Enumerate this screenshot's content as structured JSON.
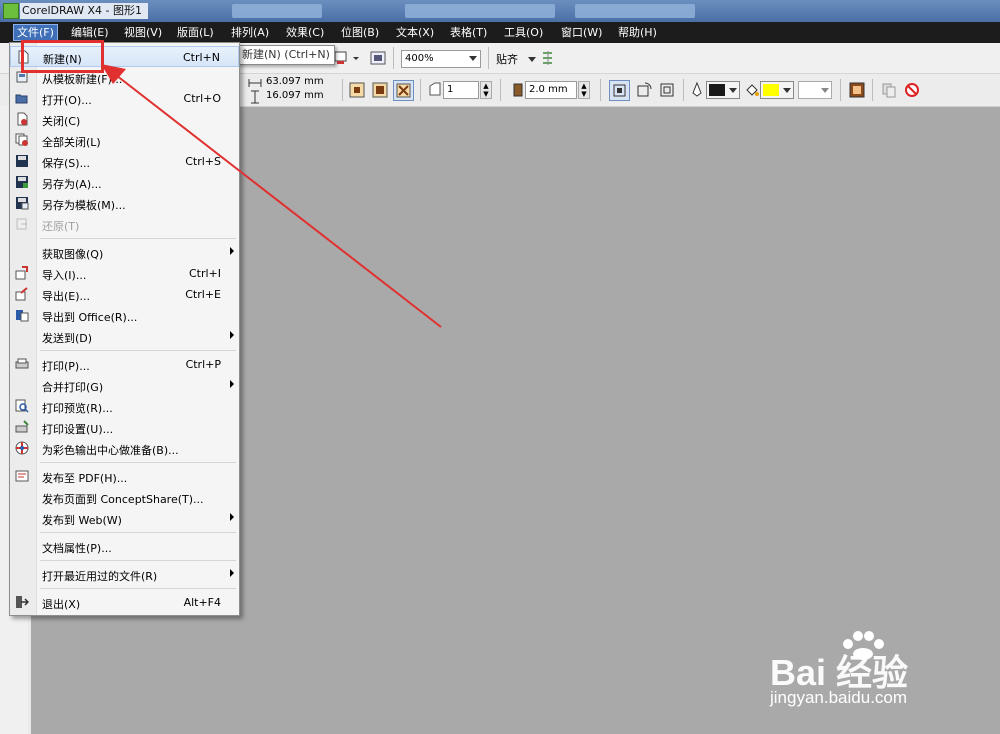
{
  "window": {
    "title": "CorelDRAW X4 - 图形1"
  },
  "menubar": [
    {
      "label": "文件(F)",
      "active": true
    },
    {
      "label": "编辑(E)"
    },
    {
      "label": "视图(V)"
    },
    {
      "label": "版面(L)"
    },
    {
      "label": "排列(A)"
    },
    {
      "label": "效果(C)"
    },
    {
      "label": "位图(B)"
    },
    {
      "label": "文本(X)"
    },
    {
      "label": "表格(T)"
    },
    {
      "label": "工具(O)"
    },
    {
      "label": "窗口(W)"
    },
    {
      "label": "帮助(H)"
    }
  ],
  "toolbar": {
    "zoom_value": "400%",
    "snap_label": "贴齐",
    "width_value": "63.097 mm",
    "height_value": "16.097 mm",
    "page_count": "1",
    "outline_width": "2.0 mm",
    "outline_color": "#1a1a1a",
    "fill_color": "#ffff00"
  },
  "tooltip": {
    "text": "新建(N) (Ctrl+N)"
  },
  "file_menu": {
    "items": [
      {
        "label": "新建(N)",
        "shortcut": "Ctrl+N",
        "icon": "new-document-icon",
        "highlighted": true
      },
      {
        "label": "从模板新建(F)...",
        "shortcut": "",
        "icon": "new-from-template-icon"
      },
      {
        "label": "打开(O)...",
        "shortcut": "Ctrl+O",
        "icon": "open-folder-icon"
      },
      {
        "label": "关闭(C)",
        "shortcut": "",
        "icon": "close-document-icon"
      },
      {
        "label": "全部关闭(L)",
        "shortcut": "",
        "icon": "close-all-icon"
      },
      {
        "label": "保存(S)...",
        "shortcut": "Ctrl+S",
        "icon": "save-icon"
      },
      {
        "label": "另存为(A)...",
        "shortcut": "",
        "icon": "save-as-icon"
      },
      {
        "label": "另存为模板(M)...",
        "shortcut": "",
        "icon": "save-as-template-icon"
      },
      {
        "label": "还原(T)",
        "shortcut": "",
        "icon": "revert-icon",
        "disabled": true
      },
      {
        "label": "获取图像(Q)",
        "shortcut": "",
        "icon": "",
        "submenu": true
      },
      {
        "label": "导入(I)...",
        "shortcut": "Ctrl+I",
        "icon": "import-icon"
      },
      {
        "label": "导出(E)...",
        "shortcut": "Ctrl+E",
        "icon": "export-icon"
      },
      {
        "label": "导出到 Office(R)...",
        "shortcut": "",
        "icon": "export-office-icon"
      },
      {
        "label": "发送到(D)",
        "shortcut": "",
        "icon": "",
        "submenu": true
      },
      {
        "label": "打印(P)...",
        "shortcut": "Ctrl+P",
        "icon": "printer-icon"
      },
      {
        "label": "合并打印(G)",
        "shortcut": "",
        "icon": "",
        "submenu": true
      },
      {
        "label": "打印预览(R)...",
        "shortcut": "",
        "icon": "print-preview-icon"
      },
      {
        "label": "打印设置(U)...",
        "shortcut": "",
        "icon": "print-setup-icon"
      },
      {
        "label": "为彩色输出中心做准备(B)...",
        "shortcut": "",
        "icon": "color-output-icon"
      },
      {
        "label": "发布至 PDF(H)...",
        "shortcut": "",
        "icon": "pdf-icon"
      },
      {
        "label": "发布页面到 ConceptShare(T)...",
        "shortcut": "",
        "icon": ""
      },
      {
        "label": "发布到 Web(W)",
        "shortcut": "",
        "icon": "",
        "submenu": true
      },
      {
        "label": "文档属性(P)...",
        "shortcut": "",
        "icon": ""
      },
      {
        "label": "打开最近用过的文件(R)",
        "shortcut": "",
        "icon": "",
        "submenu": true
      },
      {
        "label": "退出(X)",
        "shortcut": "Alt+F4",
        "icon": "exit-icon"
      }
    ]
  },
  "watermark": {
    "logo": "Bai 经验",
    "url": "jingyan.baidu.com"
  }
}
